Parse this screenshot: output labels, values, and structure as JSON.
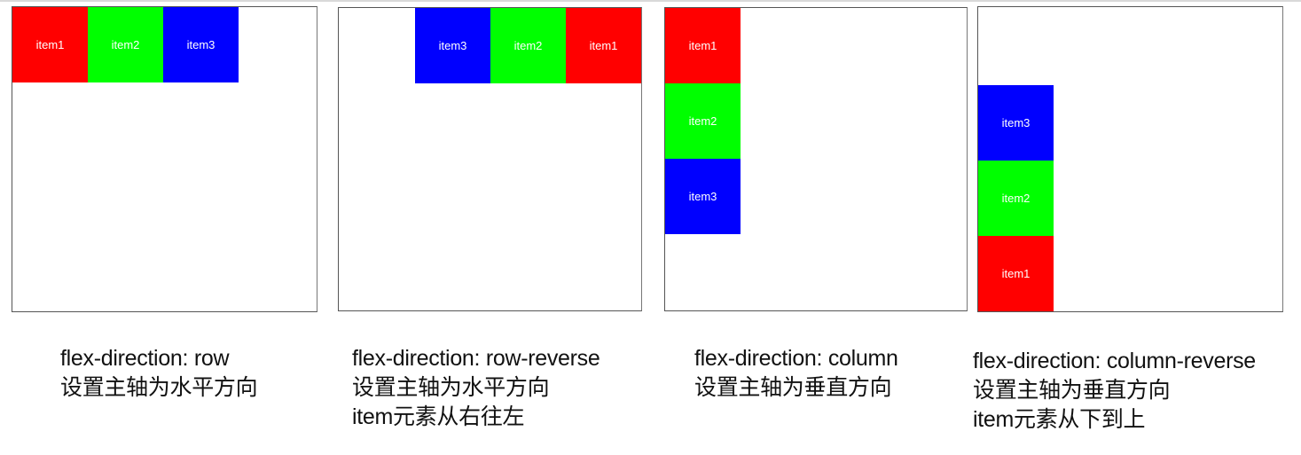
{
  "colors": {
    "red": "#ff0000",
    "green": "#00ff00",
    "blue": "#0000ff"
  },
  "panels": [
    {
      "direction": "row",
      "items": [
        {
          "label": "item1",
          "color": "#ff0000"
        },
        {
          "label": "item2",
          "color": "#00ff00"
        },
        {
          "label": "item3",
          "color": "#0000ff"
        }
      ],
      "caption": [
        "flex-direction: row",
        "设置主轴为水平方向"
      ]
    },
    {
      "direction": "row-reverse",
      "items": [
        {
          "label": "item1",
          "color": "#ff0000"
        },
        {
          "label": "item2",
          "color": "#00ff00"
        },
        {
          "label": "item3",
          "color": "#0000ff"
        }
      ],
      "caption": [
        "flex-direction: row-reverse",
        "设置主轴为水平方向",
        "item元素从右往左"
      ]
    },
    {
      "direction": "column",
      "items": [
        {
          "label": "item1",
          "color": "#ff0000"
        },
        {
          "label": "item2",
          "color": "#00ff00"
        },
        {
          "label": "item3",
          "color": "#0000ff"
        }
      ],
      "caption": [
        "flex-direction: column",
        "设置主轴为垂直方向"
      ]
    },
    {
      "direction": "column-reverse",
      "items": [
        {
          "label": "item1",
          "color": "#ff0000"
        },
        {
          "label": "item2",
          "color": "#00ff00"
        },
        {
          "label": "item3",
          "color": "#0000ff"
        }
      ],
      "caption": [
        "flex-direction: column-reverse",
        "设置主轴为垂直方向",
        "item元素从下到上"
      ]
    }
  ]
}
